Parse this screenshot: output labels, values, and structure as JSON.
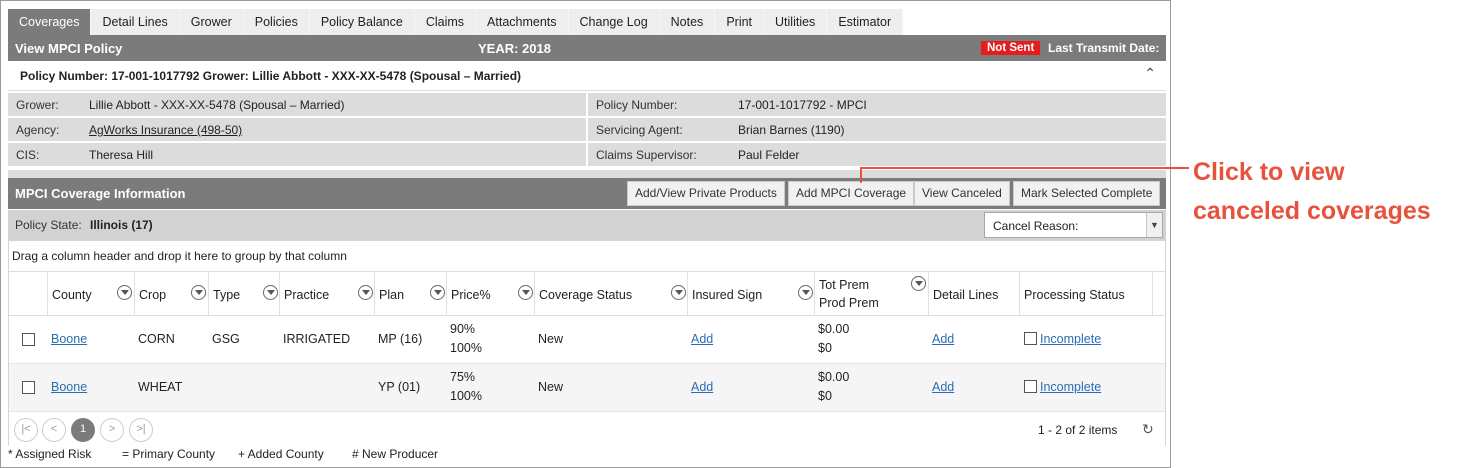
{
  "tabs": [
    {
      "label": "Coverages",
      "active": true
    },
    {
      "label": "Detail Lines"
    },
    {
      "label": "Grower"
    },
    {
      "label": "Policies"
    },
    {
      "label": "Policy Balance"
    },
    {
      "label": "Claims"
    },
    {
      "label": "Attachments"
    },
    {
      "label": "Change Log"
    },
    {
      "label": "Notes"
    },
    {
      "label": "Print"
    },
    {
      "label": "Utilities"
    },
    {
      "label": "Estimator"
    }
  ],
  "titlebar": {
    "title": "View MPCI Policy",
    "year": "YEAR: 2018",
    "status_badge": "Not Sent",
    "last_transmit": "Last Transmit Date:"
  },
  "policy_summary": "Policy Number: 17-001-1017792 Grower: Lillie Abbott - XXX-XX-5478 (Spousal – Married)",
  "info": {
    "grower_label": "Grower:",
    "grower_value": "Lillie Abbott - XXX-XX-5478 (Spousal – Married)",
    "agency_label": "Agency:",
    "agency_value": "AgWorks Insurance (498-50)",
    "cis_label": "CIS:",
    "cis_value": "Theresa Hill",
    "policy_number_label": "Policy Number:",
    "policy_number_value": "17-001-1017792 - MPCI",
    "servicing_agent_label": "Servicing Agent:",
    "servicing_agent_value": "Brian Barnes (1190)",
    "claims_supervisor_label": "Claims Supervisor:",
    "claims_supervisor_value": "Paul Felder"
  },
  "coverage_section": {
    "title": "MPCI Coverage Information",
    "buttons": {
      "private_products": "Add/View Private Products",
      "add_mpci": "Add MPCI Coverage",
      "view_canceled": "View Canceled",
      "mark_complete": "Mark Selected Complete"
    }
  },
  "policy_state": {
    "label": "Policy State:",
    "value": "Illinois (17)",
    "cancel_reason": "Cancel Reason:"
  },
  "grid": {
    "group_hint": "Drag a column header and drop it here to group by that column",
    "headers": {
      "county": "County",
      "crop": "Crop",
      "type": "Type",
      "practice": "Practice",
      "plan": "Plan",
      "price": "Price%",
      "coverage_status": "Coverage Status",
      "insured_sign": "Insured Sign",
      "tot_prem": "Tot Prem",
      "prod_prem": "Prod Prem",
      "detail_lines": "Detail Lines",
      "processing_status": "Processing Status"
    },
    "rows": [
      {
        "county": "Boone",
        "crop": "CORN",
        "type": "GSG",
        "practice": "IRRIGATED",
        "plan": "MP (16)",
        "price_top": "90%",
        "price_bottom": "100%",
        "coverage_status": "New",
        "insured_sign": "Add",
        "tot_prem": "$0.00",
        "prod_prem": "$0",
        "detail_lines": "Add",
        "processing_status": "Incomplete"
      },
      {
        "county": "Boone",
        "crop": "WHEAT",
        "type": "",
        "practice": "",
        "plan": "YP (01)",
        "price_top": "75%",
        "price_bottom": "100%",
        "coverage_status": "New",
        "insured_sign": "Add",
        "tot_prem": "$0.00",
        "prod_prem": "$0",
        "detail_lines": "Add",
        "processing_status": "Incomplete"
      }
    ],
    "pager": {
      "current_page": "1",
      "first": "|<",
      "prev": "<",
      "next": ">",
      "last": ">|",
      "info": "1 - 2 of 2 items",
      "refresh": "↻"
    }
  },
  "footer": {
    "assigned_risk": "* Assigned Risk",
    "primary_county": "= Primary County",
    "added_county": "+ Added County",
    "new_producer": "# New Producer"
  },
  "callout": {
    "line1": "Click to view",
    "line2": "canceled coverages",
    "color": "#e8523c"
  }
}
